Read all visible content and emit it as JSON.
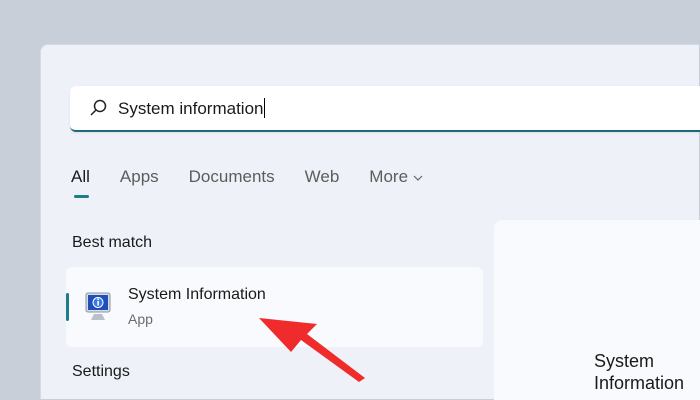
{
  "search": {
    "value": "System information"
  },
  "tabs": [
    {
      "label": "All"
    },
    {
      "label": "Apps"
    },
    {
      "label": "Documents"
    },
    {
      "label": "Web"
    },
    {
      "label": "More"
    }
  ],
  "best_match": {
    "heading": "Best match",
    "title": "System Information",
    "subtitle": "App"
  },
  "settings": {
    "heading": "Settings"
  },
  "preview": {
    "title": "System Information"
  },
  "colors": {
    "accent": "#1d7d89",
    "arrow": "#f02b2b"
  }
}
